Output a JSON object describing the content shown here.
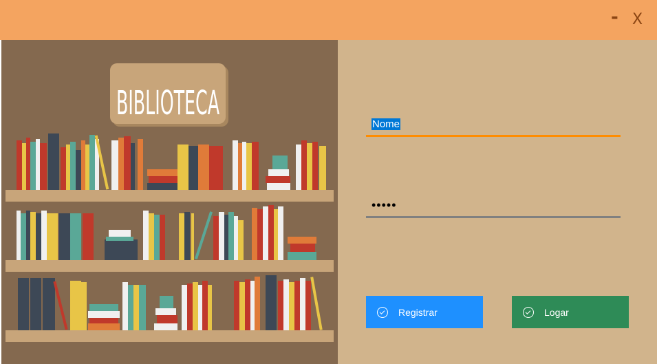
{
  "window": {
    "minimize_label": "-",
    "close_label": "X",
    "titlebar_color": "#f4a460"
  },
  "illustration": {
    "sign_text": "BIBLIOTECA",
    "background_color": "#84694f"
  },
  "form": {
    "username_value": "Nome",
    "password_value": "•••••",
    "username_underline_color": "#ff8c00",
    "password_underline_color": "#808080"
  },
  "buttons": {
    "register_label": "Registrar",
    "login_label": "Logar",
    "register_color": "#1e90ff",
    "login_color": "#2e8b57"
  }
}
